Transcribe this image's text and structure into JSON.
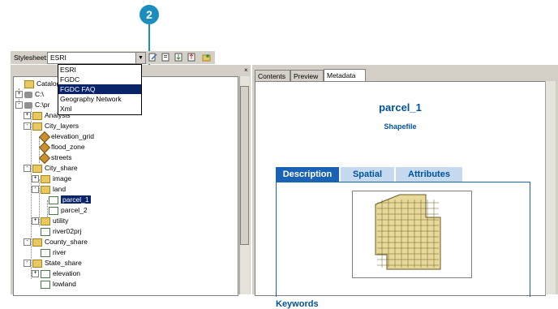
{
  "callout": {
    "number": "2"
  },
  "toolbar": {
    "stylesheet_label": "Stylesheet:",
    "stylesheet_value": "ESRI",
    "dropdown_arrow": "▼",
    "options": [
      "ESRI",
      "FGDC",
      "FGDC FAQ",
      "Geography Network",
      "Xml"
    ],
    "highlighted_option": "FGDC FAQ"
  },
  "tree": {
    "close_glyph": "×",
    "rows": [
      {
        "label": "Catalog",
        "indent": 0,
        "icon": "catalog-icon",
        "toggle": ""
      },
      {
        "label": "C:\\",
        "indent": 0,
        "icon": "drive-icon",
        "toggle": "+"
      },
      {
        "label": "C:\\pr",
        "indent": 0,
        "icon": "drive-icon",
        "toggle": "-"
      },
      {
        "label": "Analysis",
        "indent": 1,
        "icon": "folder-icon",
        "toggle": "+"
      },
      {
        "label": "City_layers",
        "indent": 1,
        "icon": "folder-icon",
        "toggle": "-"
      },
      {
        "label": "elevation_grid",
        "indent": 2,
        "icon": "point-layer-icon",
        "toggle": ""
      },
      {
        "label": "flood_zone",
        "indent": 2,
        "icon": "point-layer-icon",
        "toggle": ""
      },
      {
        "label": "streets",
        "indent": 2,
        "icon": "point-layer-icon",
        "toggle": ""
      },
      {
        "label": "City_share",
        "indent": 1,
        "icon": "folder-icon",
        "toggle": "-"
      },
      {
        "label": "image",
        "indent": 2,
        "icon": "folder-icon",
        "toggle": "+"
      },
      {
        "label": "land",
        "indent": 2,
        "icon": "folder-icon",
        "toggle": "-"
      },
      {
        "label": "parcel_1",
        "indent": 3,
        "icon": "shapefile-icon",
        "toggle": "",
        "selected": true
      },
      {
        "label": "parcel_2",
        "indent": 3,
        "icon": "shapefile-icon",
        "toggle": ""
      },
      {
        "label": "utility",
        "indent": 2,
        "icon": "folder-icon",
        "toggle": "+"
      },
      {
        "label": "river02prj",
        "indent": 2,
        "icon": "shapefile-icon",
        "toggle": ""
      },
      {
        "label": "County_share",
        "indent": 1,
        "icon": "folder-icon",
        "toggle": "-"
      },
      {
        "label": "river",
        "indent": 2,
        "icon": "shapefile-icon",
        "toggle": ""
      },
      {
        "label": "State_share",
        "indent": 1,
        "icon": "folder-icon",
        "toggle": "-"
      },
      {
        "label": "elevation",
        "indent": 2,
        "icon": "grid-icon",
        "toggle": "+"
      },
      {
        "label": "lowland",
        "indent": 2,
        "icon": "shapefile-icon",
        "toggle": ""
      }
    ]
  },
  "right": {
    "tabs": [
      "Contents",
      "Preview",
      "Metadata"
    ],
    "active_tab": "Metadata",
    "title": "parcel_1",
    "subtitle": "Shapefile",
    "md_tabs": [
      "Description",
      "Spatial",
      "Attributes"
    ],
    "active_md_tab": "Description",
    "keywords_heading": "Keywords"
  },
  "colors": {
    "accent": "#1a62b3",
    "callout": "#1a8fbf",
    "title": "#00529b"
  }
}
